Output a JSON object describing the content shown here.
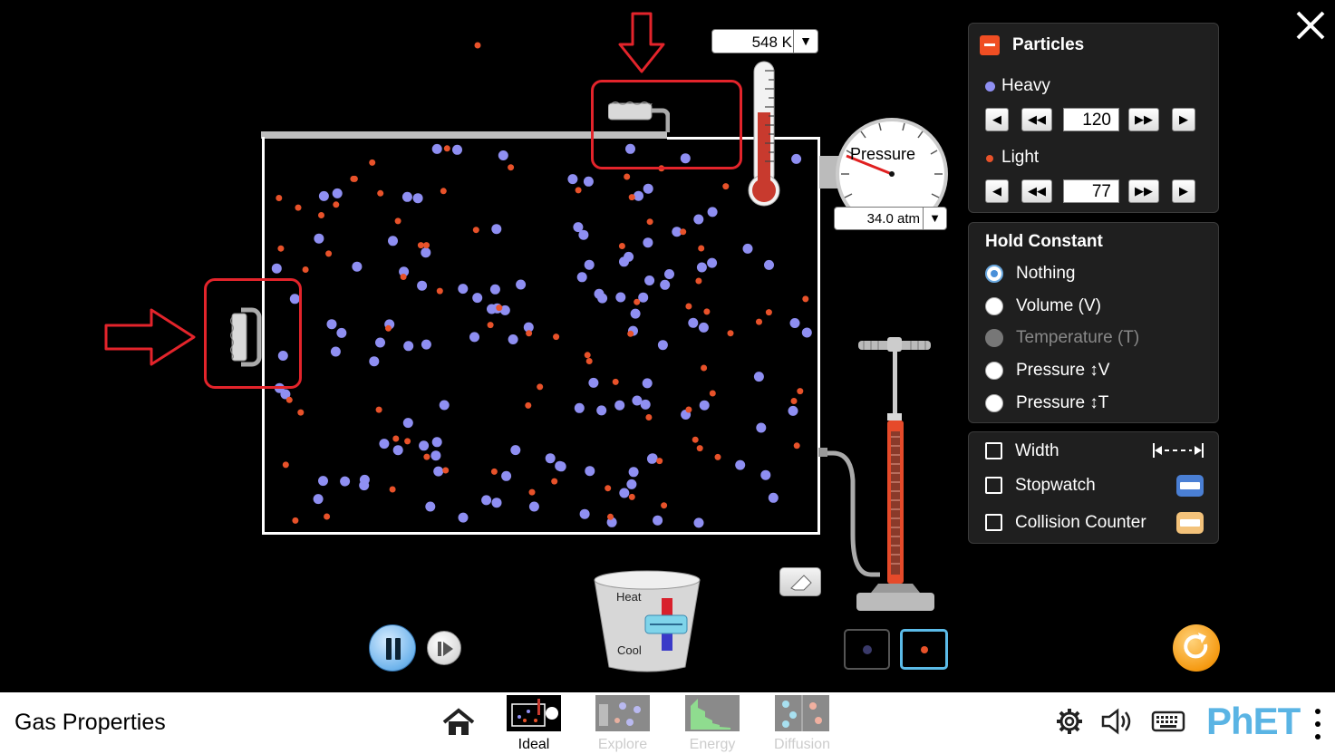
{
  "app": {
    "title": "Gas Properties"
  },
  "thermometer": {
    "value": "548 K",
    "dropdown_icon": "triangle-down-icon"
  },
  "pressure_gauge": {
    "label": "Pressure",
    "value": "34.0 atm",
    "dropdown_icon": "triangle-down-icon"
  },
  "heater": {
    "heat_label": "Heat",
    "cool_label": "Cool"
  },
  "particles_panel": {
    "title": "Particles",
    "heavy": {
      "label": "Heavy",
      "count": "120",
      "color": "#8f8ff2"
    },
    "light": {
      "label": "Light",
      "count": "77",
      "color": "#e8522a"
    }
  },
  "hold_constant": {
    "title": "Hold Constant",
    "options": [
      {
        "label": "Nothing",
        "selected": true,
        "enabled": true
      },
      {
        "label": "Volume (V)",
        "selected": false,
        "enabled": true
      },
      {
        "label": "Temperature (T)",
        "selected": false,
        "enabled": false
      },
      {
        "label": "Pressure ↕V",
        "selected": false,
        "enabled": true
      },
      {
        "label": "Pressure ↕T",
        "selected": false,
        "enabled": true
      }
    ]
  },
  "tools_panel": {
    "width": {
      "label": "Width",
      "checked": false,
      "icon": "width-arrows-icon"
    },
    "stopwatch": {
      "label": "Stopwatch",
      "checked": false,
      "icon": "stopwatch-icon"
    },
    "collision_counter": {
      "label": "Collision Counter",
      "checked": false,
      "icon": "collision-counter-icon"
    }
  },
  "nav": {
    "screens": [
      {
        "label": "Ideal",
        "active": true
      },
      {
        "label": "Explore",
        "active": false
      },
      {
        "label": "Energy",
        "active": false
      },
      {
        "label": "Diffusion",
        "active": false
      }
    ],
    "brand": "PhET"
  },
  "colors": {
    "accent": "#f04e23",
    "heavy_particle": "#8f8ff2",
    "light_particle": "#e8522a",
    "annotation": "#e3242b",
    "selection": "#5bbbe8"
  }
}
